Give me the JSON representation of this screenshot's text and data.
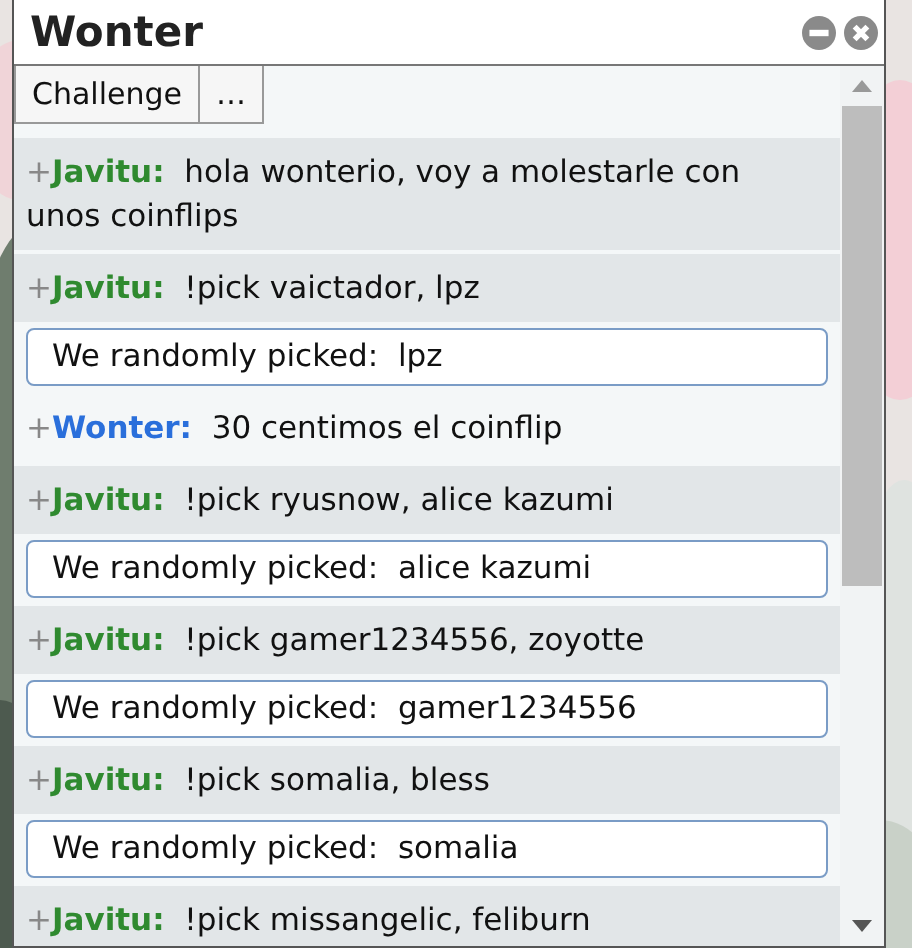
{
  "window": {
    "title": "Wonter"
  },
  "tabs": [
    {
      "label": "Challenge"
    },
    {
      "label": "…"
    }
  ],
  "messages": [
    {
      "kind": "chat",
      "rank": "+",
      "name": "Javitu:",
      "color": "#2f8a2f",
      "self": false,
      "text": "hola wonterio, voy a molestarle con unos coinflips"
    },
    {
      "kind": "chat",
      "rank": "+",
      "name": "Javitu:",
      "color": "#2f8a2f",
      "self": false,
      "text": "!pick vaictador, lpz"
    },
    {
      "kind": "pick",
      "text": "We randomly picked:  lpz"
    },
    {
      "kind": "chat",
      "rank": "+",
      "name": "Wonter:",
      "color": "#2a6fdb",
      "self": true,
      "text": "30 centimos el coinflip"
    },
    {
      "kind": "chat",
      "rank": "+",
      "name": "Javitu:",
      "color": "#2f8a2f",
      "self": false,
      "text": "!pick ryusnow, alice kazumi"
    },
    {
      "kind": "pick",
      "text": "We randomly picked:  alice kazumi"
    },
    {
      "kind": "chat",
      "rank": "+",
      "name": "Javitu:",
      "color": "#2f8a2f",
      "self": false,
      "text": "!pick gamer1234556, zoyotte"
    },
    {
      "kind": "pick",
      "text": "We randomly picked:  gamer1234556"
    },
    {
      "kind": "chat",
      "rank": "+",
      "name": "Javitu:",
      "color": "#2f8a2f",
      "self": false,
      "text": "!pick somalia, bless"
    },
    {
      "kind": "pick",
      "text": "We randomly picked:  somalia"
    },
    {
      "kind": "chat",
      "rank": "+",
      "name": "Javitu:",
      "color": "#2f8a2f",
      "self": false,
      "text": "!pick missangelic, feliburn"
    }
  ]
}
